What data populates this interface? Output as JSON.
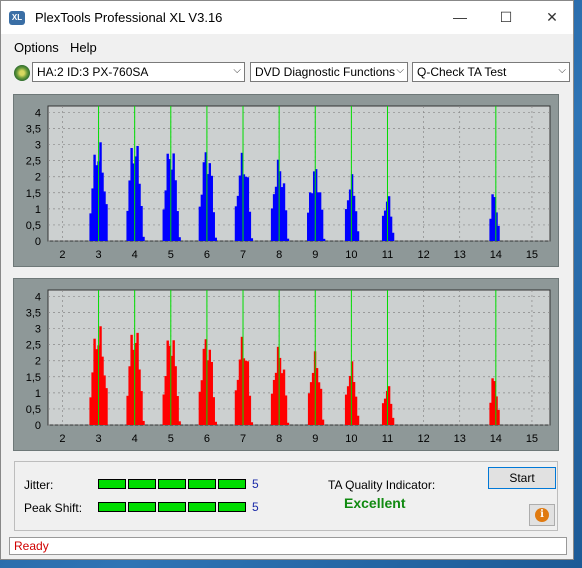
{
  "window": {
    "title": "PlexTools Professional XL V3.16",
    "icon_text": "XL",
    "minimize_glyph": "—",
    "maximize_glyph": "☐",
    "close_glyph": "✕"
  },
  "menu": {
    "items": [
      "Options",
      "Help"
    ]
  },
  "toolbar": {
    "drive": "HA:2 ID:3  PX-760SA",
    "function": "DVD Diagnostic Functions",
    "test": "Q-Check TA Test",
    "dropdown_glyph": "⌵"
  },
  "colors": {
    "top_bars": "#0000ff",
    "bottom_bars": "#ff0000",
    "marker_lines": "#00dd00",
    "plot_bg": "#ccd0d0"
  },
  "chart_data": [
    {
      "type": "bar",
      "name": "top",
      "x_ticks": [
        2,
        3,
        4,
        5,
        6,
        7,
        8,
        9,
        10,
        11,
        12,
        13,
        14,
        15
      ],
      "y_ticks": [
        0,
        0.5,
        1,
        1.5,
        2,
        2.5,
        3,
        3.5,
        4
      ],
      "y_tick_labels": [
        "0",
        "0,5",
        "1",
        "1,5",
        "2",
        "2,5",
        "3",
        "3,5",
        "4"
      ],
      "xlim": [
        1.6,
        15.5
      ],
      "ylim": [
        0,
        4.2
      ],
      "markers": [
        3,
        4,
        5,
        6,
        7,
        8,
        9,
        10,
        11,
        14
      ],
      "peaks": [
        {
          "center": 3.0,
          "height": 3.2,
          "width": 0.55
        },
        {
          "center": 4.0,
          "height": 3.3,
          "width": 0.5
        },
        {
          "center": 5.0,
          "height": 3.1,
          "width": 0.5
        },
        {
          "center": 6.0,
          "height": 3.0,
          "width": 0.5
        },
        {
          "center": 7.0,
          "height": 2.8,
          "width": 0.5
        },
        {
          "center": 8.0,
          "height": 2.6,
          "width": 0.5
        },
        {
          "center": 9.0,
          "height": 2.4,
          "width": 0.5
        },
        {
          "center": 10.0,
          "height": 2.1,
          "width": 0.4
        },
        {
          "center": 11.0,
          "height": 1.5,
          "width": 0.35
        },
        {
          "center": 13.95,
          "height": 1.6,
          "width": 0.3
        }
      ]
    },
    {
      "type": "bar",
      "name": "bottom",
      "x_ticks": [
        2,
        3,
        4,
        5,
        6,
        7,
        8,
        9,
        10,
        11,
        12,
        13,
        14,
        15
      ],
      "y_ticks": [
        0,
        0.5,
        1,
        1.5,
        2,
        2.5,
        3,
        3.5,
        4
      ],
      "y_tick_labels": [
        "0",
        "0,5",
        "1",
        "1,5",
        "2",
        "2,5",
        "3",
        "3,5",
        "4"
      ],
      "xlim": [
        1.6,
        15.5
      ],
      "ylim": [
        0,
        4.2
      ],
      "markers": [
        3,
        4,
        5,
        6,
        7,
        8,
        9,
        10,
        11,
        14
      ],
      "peaks": [
        {
          "center": 3.0,
          "height": 3.2,
          "width": 0.55
        },
        {
          "center": 4.0,
          "height": 3.2,
          "width": 0.5
        },
        {
          "center": 5.0,
          "height": 3.0,
          "width": 0.5
        },
        {
          "center": 6.0,
          "height": 2.9,
          "width": 0.5
        },
        {
          "center": 7.0,
          "height": 2.8,
          "width": 0.5
        },
        {
          "center": 8.0,
          "height": 2.5,
          "width": 0.5
        },
        {
          "center": 9.0,
          "height": 2.3,
          "width": 0.45
        },
        {
          "center": 10.0,
          "height": 2.0,
          "width": 0.4
        },
        {
          "center": 11.0,
          "height": 1.3,
          "width": 0.35
        },
        {
          "center": 13.95,
          "height": 1.6,
          "width": 0.3
        }
      ]
    }
  ],
  "results": {
    "jitter_label": "Jitter:",
    "jitter_value": "5",
    "jitter_segments": 5,
    "peak_shift_label": "Peak Shift:",
    "peak_shift_value": "5",
    "peak_shift_segments": 5,
    "ta_label": "TA Quality Indicator:",
    "ta_value": "Excellent",
    "start_label": "Start",
    "info_glyph": "i"
  },
  "status": {
    "text": "Ready"
  }
}
